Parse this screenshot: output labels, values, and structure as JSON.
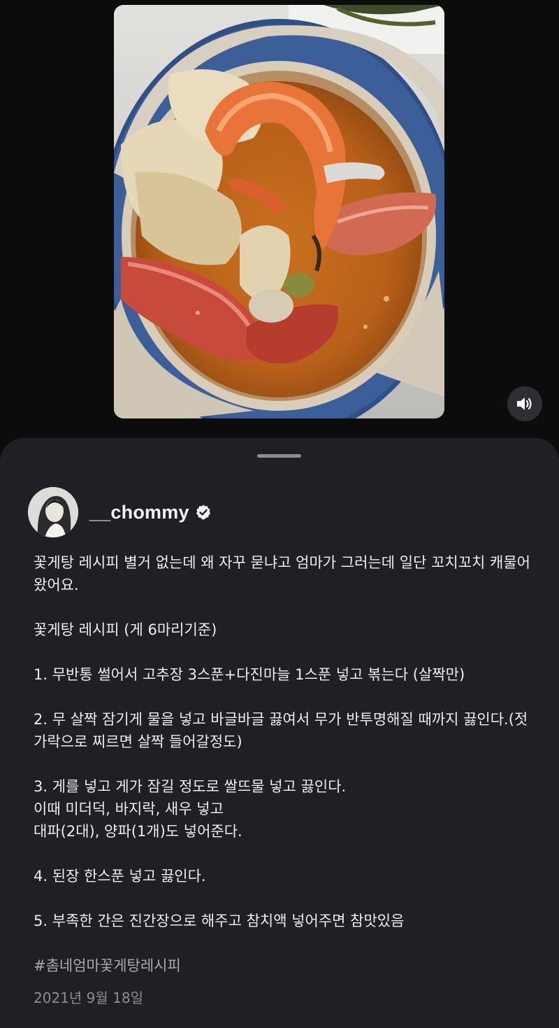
{
  "user": {
    "username": "__chommy",
    "verified": true
  },
  "media": {
    "photo_icon": "food-photo",
    "sound_icon": "speaker-icon"
  },
  "post": {
    "intro": "꽃게탕 레시피 별거 없는데 왜 자꾸 묻냐고 엄마가 그러는데 일단 꼬치꼬치 캐물어 왔어요.",
    "recipe_title": "꽃게탕 레시피 (게 6마리기준)",
    "steps": [
      "1. 무반통 썰어서 고추장 3스푼+다진마늘 1스푼 넣고 볶는다 (살짝만)",
      "2. 무 살짝 잠기게 물을 넣고 바글바글 끓여서 무가 반투명해질 때까지 끓인다.(젓가락으로 찌르면 살짝 들어갈정도)",
      "3. 게를 넣고 게가 잠길 정도로 쌀뜨물 넣고 끓인다.\n이때 미더덕, 바지락, 새우 넣고\n대파(2대), 양파(1개)도 넣어준다.",
      "4. 된장 한스푼 넣고 끓인다.",
      "5. 부족한 간은 진간장으로 해주고 참치액 넣어주면 참맛있음"
    ],
    "hashtag": "#촘네엄마꽃게탕레시피",
    "date": "2021년 9월 18일"
  },
  "colors": {
    "background": "#0b0b0c",
    "sheet": "#1f2023",
    "text": "#ededee",
    "muted": "#8d8e93"
  }
}
